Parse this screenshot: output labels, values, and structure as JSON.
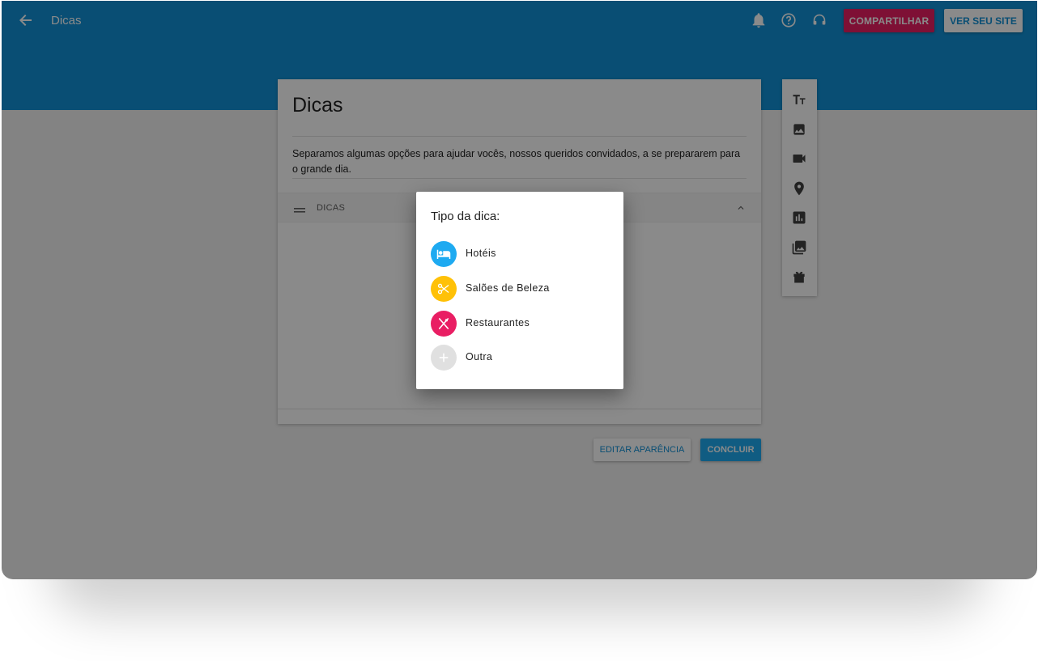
{
  "header": {
    "title": "Dicas",
    "share_label": "COMPARTILHAR",
    "site_label": "VER SEU SITE",
    "icons": [
      "back-arrow-icon",
      "bell-icon",
      "help-icon",
      "support-icon"
    ]
  },
  "card": {
    "title": "Dicas",
    "description": "Separamos algumas opções para ajudar vocês, nossos queridos convidados, a se prepararem para o grande dia.",
    "section_label": "DICAS"
  },
  "toolbox": {
    "tools": [
      "text-icon",
      "image-icon",
      "video-icon",
      "location-icon",
      "chart-icon",
      "gallery-icon",
      "gift-icon"
    ]
  },
  "actions": {
    "appearance_label": "EDITAR APARÊNCIA",
    "done_label": "CONCLUIR"
  },
  "dialog": {
    "title": "Tipo da dica:",
    "options": [
      {
        "label": "Hotéis",
        "icon": "hotel-icon",
        "color": "#1eaaf1"
      },
      {
        "label": "Salões de Beleza",
        "icon": "scissors-icon",
        "color": "#ffc107"
      },
      {
        "label": "Restaurantes",
        "icon": "cutlery-icon",
        "color": "#e91e63"
      },
      {
        "label": "Outra",
        "icon": "plus-icon",
        "color": "#e0e0e0"
      }
    ]
  },
  "colors": {
    "primary": "#1191d6",
    "accent": "#e91e63"
  }
}
